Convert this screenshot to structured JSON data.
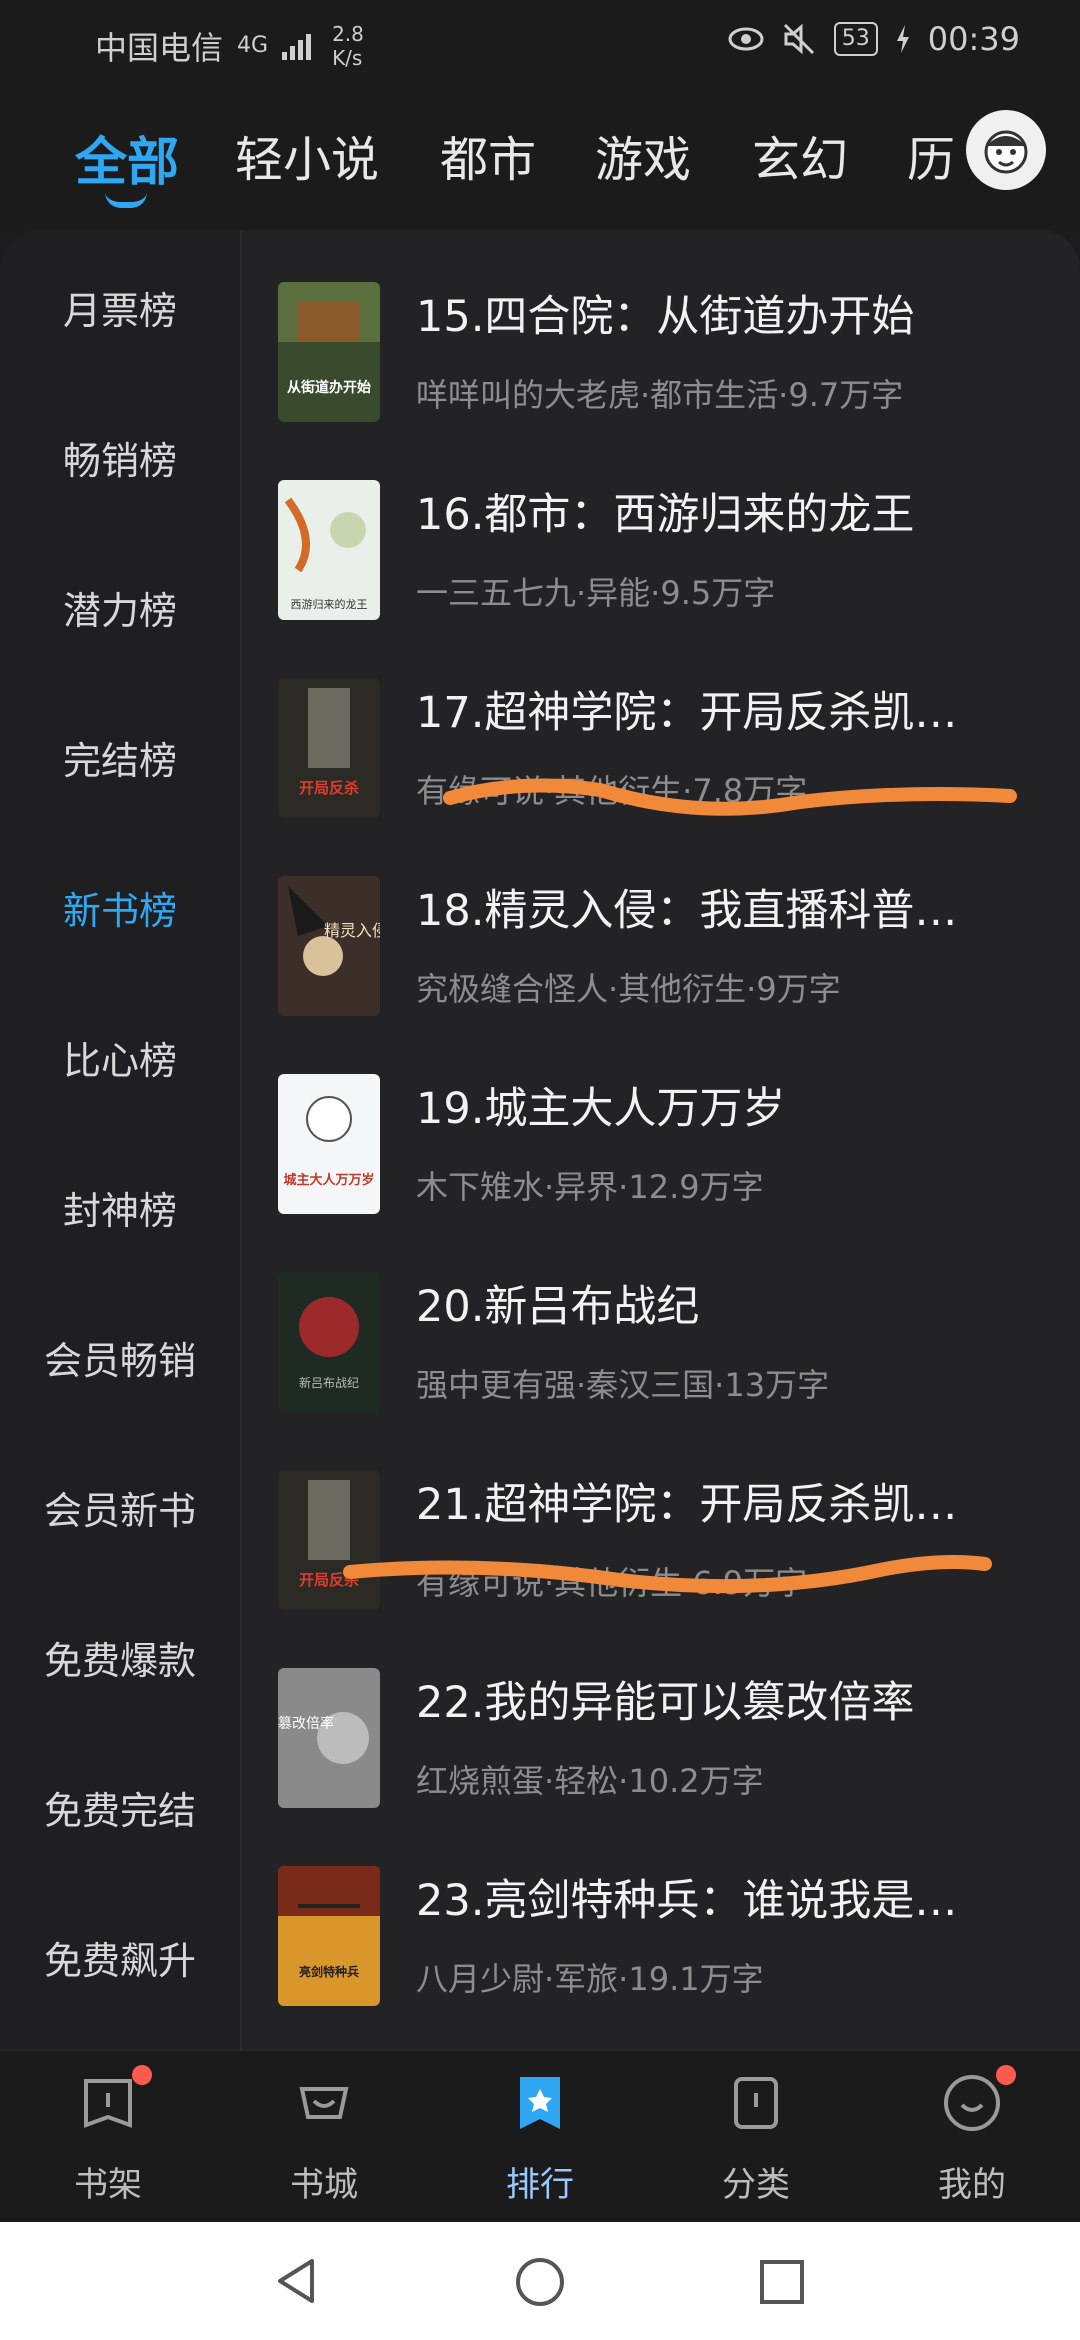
{
  "status_bar": {
    "carrier": "中国电信",
    "network": "4G",
    "speed_value": "2.8",
    "speed_unit": "K/s",
    "battery": "53",
    "time": "00:39"
  },
  "top_tabs": [
    "全部",
    "轻小说",
    "都市",
    "游戏",
    "玄幻",
    "历"
  ],
  "active_tab": "全部",
  "sidebar": {
    "items": [
      "月票榜",
      "畅销榜",
      "潜力榜",
      "完结榜",
      "新书榜",
      "比心榜",
      "封神榜",
      "会员畅销",
      "会员新书",
      "免费爆款",
      "免费完结",
      "免费飙升"
    ],
    "active": "新书榜"
  },
  "books": [
    {
      "title": "15.四合院：从街道办开始",
      "meta": "咩咩叫的大老虎·都市生活·9.7万字",
      "cover_text": "从街道办开始"
    },
    {
      "title": "16.都市：西游归来的龙王",
      "meta": "一三五七九·异能·9.5万字",
      "cover_text": "西游归来的龙王"
    },
    {
      "title": "17.超神学院：开局反杀凯…",
      "meta": "有缘可说·其他衍生·7.8万字",
      "cover_text": "开局反杀"
    },
    {
      "title": "18.精灵入侵：我直播科普…",
      "meta": "究极缝合怪人·其他衍生·9万字",
      "cover_text": "精灵入侵"
    },
    {
      "title": "19.城主大人万万岁",
      "meta": "木下雉水·异界·12.9万字",
      "cover_text": "城主大人万万岁"
    },
    {
      "title": "20.新吕布战纪",
      "meta": "强中更有强·秦汉三国·13万字",
      "cover_text": "新吕布战纪"
    },
    {
      "title": "21.超神学院：开局反杀凯…",
      "meta": "有缘可说·其他衍生·6.9万字",
      "cover_text": "开局反杀"
    },
    {
      "title": "22.我的异能可以篡改倍率",
      "meta": "红烧煎蛋·轻松·10.2万字",
      "cover_text": "篡改倍率"
    },
    {
      "title": "23.亮剑特种兵：谁说我是…",
      "meta": "八月少尉·军旅·19.1万字",
      "cover_text": "亮剑特种兵"
    }
  ],
  "bottom_nav": [
    {
      "label": "书架",
      "icon": "bookshelf-icon",
      "badge": true
    },
    {
      "label": "书城",
      "icon": "bookstore-icon",
      "badge": false
    },
    {
      "label": "排行",
      "icon": "ranking-icon",
      "badge": false
    },
    {
      "label": "分类",
      "icon": "category-icon",
      "badge": false
    },
    {
      "label": "我的",
      "icon": "profile-icon",
      "badge": true
    }
  ],
  "active_bottom": "排行",
  "colors": {
    "accent": "#2fa7f2",
    "badge": "#ff5a4e",
    "scribble": "#f0893a"
  }
}
